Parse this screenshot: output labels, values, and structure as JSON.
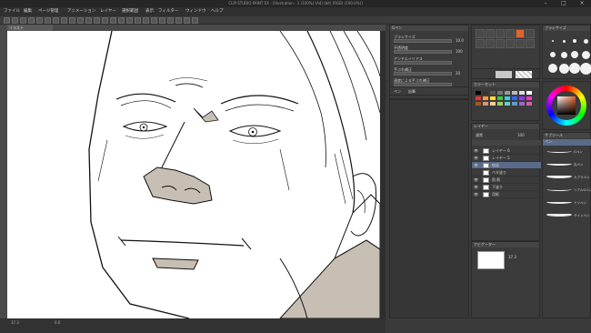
{
  "colors": {
    "accent": "#e3632b",
    "selection": "#5a6a8a",
    "skin_shadow": "#c7bfb3",
    "hair_shadow": "#c7bfb3"
  },
  "titlebar": {
    "text": "CLIP STUDIO PAINT EX - [Illustration - 1 (100%) (A4) (bit) (RGB) (100.0%)]",
    "min_icon": "minimize-icon",
    "max_icon": "maximize-icon",
    "close_icon": "close-icon",
    "min": "–",
    "max": "□",
    "close": "×"
  },
  "menu": {
    "items": [
      "ファイル",
      "編集",
      "ページ管理",
      "アニメーション",
      "レイヤー",
      "選択範囲",
      "表示",
      "フィルター",
      "ウィンドウ",
      "ヘルプ"
    ]
  },
  "document": {
    "tab_label": "イラスト"
  },
  "status": {
    "zoom": "37.3",
    "angle": "0.0"
  },
  "tool_property": {
    "title": "Gペン",
    "rows": [
      {
        "label": "ブラシサイズ",
        "value": "10.0"
      },
      {
        "label": "不透明度",
        "value": "100"
      },
      {
        "label": "アンチエイリアス",
        "value": ""
      },
      {
        "label": "手ぶれ補正",
        "value": "20"
      },
      {
        "label": "速度による手ぶれ補正",
        "value": ""
      }
    ],
    "sub_tabs": [
      "ペン",
      "鉛筆"
    ]
  },
  "tools": {
    "icons": [
      "brush-icon",
      "pen-icon",
      "eraser-icon",
      "fill-icon",
      "gradient-icon",
      "text-icon",
      "selection-icon",
      "move-icon",
      "zoom-icon",
      "hand-icon",
      "eyedropper-icon",
      "figure-icon"
    ]
  },
  "brush_size_panel": {
    "title": "ブラシサイズ"
  },
  "color_set": {
    "title": "カラーセット"
  },
  "layers": {
    "title": "レイヤー",
    "blend_mode": "通常",
    "opacity": "100",
    "rows": [
      {
        "name": "レイヤー 6",
        "visible": "👁",
        "selected": false
      },
      {
        "name": "レイヤー 5",
        "visible": "👁",
        "selected": false
      },
      {
        "name": "線画",
        "visible": "👁",
        "selected": true
      },
      {
        "name": "ベタ塗り",
        "visible": "",
        "selected": false
      },
      {
        "name": "肌 影",
        "visible": "👁",
        "selected": false
      },
      {
        "name": "下塗り",
        "visible": "👁",
        "selected": false
      },
      {
        "name": "用紙",
        "visible": "👁",
        "selected": false
      }
    ]
  },
  "sub_tool": {
    "title": "サブツール",
    "tabs": [
      "ペン",
      "マーカー"
    ],
    "strokes": [
      "Gペン",
      "丸ペン",
      "カブラペン",
      "リアルGペン",
      "ミリペン",
      "サインペン"
    ]
  },
  "navigator": {
    "title": "ナビゲーター",
    "zoom": "37.3"
  }
}
